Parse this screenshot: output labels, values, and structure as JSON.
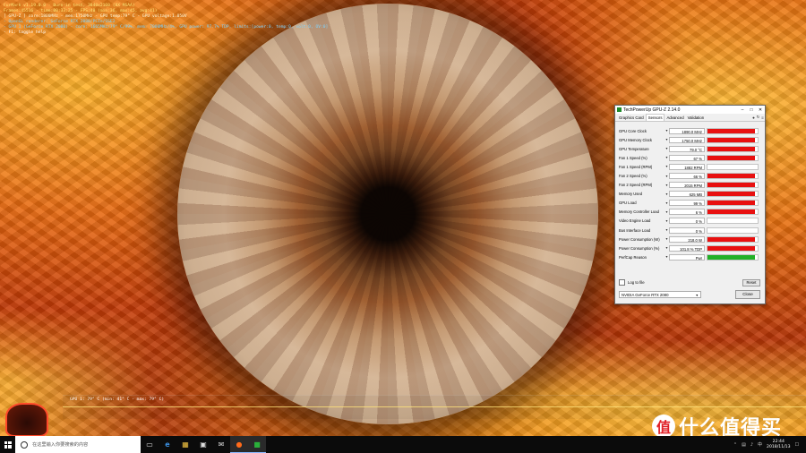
{
  "furmark_osd": {
    "line1": "FurMark v1.19.0.0 - Burn-in test, 3840x2160 (8X MSAA)",
    "line2": "Frames:45516 - time:00:33:25 - FPS:40 (min:36, max:45, avg:41)",
    "line3": "[ GPU-Z ] core:1800MHz - mem:1750MHz - GPU temp:79° C - GPU voltage:1.050V",
    "line4": "- OpenGL renderer: GeForce RTX 2080/PCIe/SSE2",
    "line5": "- GPU 1 (GeForce RTX 2080) - core: 1665MHz/79° C/99%, mem: 7000MHz/4%, GPU power: 97.7% TDP, limits:[power:0, temp:0, volt:0, OV:0]",
    "line6": "- F1: toggle help",
    "graph_label": "GPU 1: 79° C (min: 41° C - max: 79° C)"
  },
  "gpuz": {
    "title": "TechPowerUp GPU-Z 2.14.0",
    "tabs": [
      "Graphics Card",
      "Sensors",
      "Advanced",
      "Validation"
    ],
    "active_tab": "Sensors",
    "sensors": [
      {
        "label": "GPU Core Clock",
        "value": "1890.0 MHz",
        "fill": 0.95,
        "style": "red"
      },
      {
        "label": "GPU Memory Clock",
        "value": "1750.0 MHz",
        "fill": 0.95,
        "style": "red"
      },
      {
        "label": "GPU Temperature",
        "value": "79.0 °C",
        "fill": 0.95,
        "style": "red"
      },
      {
        "label": "Fan 1 Speed (%)",
        "value": "67 %",
        "fill": 0.95,
        "style": "red"
      },
      {
        "label": "Fan 1 Speed (RPM)",
        "value": "1882 RPM",
        "fill": 0.0,
        "style": "red"
      },
      {
        "label": "Fan 2 Speed (%)",
        "value": "66 %",
        "fill": 0.95,
        "style": "red"
      },
      {
        "label": "Fan 2 Speed (RPM)",
        "value": "2015 RPM",
        "fill": 0.95,
        "style": "red"
      },
      {
        "label": "Memory Used",
        "value": "625 MB",
        "fill": 0.95,
        "style": "red"
      },
      {
        "label": "GPU Load",
        "value": "99 %",
        "fill": 0.95,
        "style": "red"
      },
      {
        "label": "Memory Controller Load",
        "value": "6 %",
        "fill": 0.95,
        "style": "red"
      },
      {
        "label": "Video Engine Load",
        "value": "0 %",
        "fill": 0.0,
        "style": "red"
      },
      {
        "label": "Bus Interface Load",
        "value": "0 %",
        "fill": 0.0,
        "style": "red"
      },
      {
        "label": "Power Consumption (W)",
        "value": "218.0 W",
        "fill": 0.95,
        "style": "red"
      },
      {
        "label": "Power Consumption (%)",
        "value": "101.8 % TDP",
        "fill": 0.95,
        "style": "red"
      },
      {
        "label": "PerfCap Reason",
        "value": "Pwr",
        "fill": 0.95,
        "style": "green"
      }
    ],
    "log_label": "Log to file",
    "reset_label": "Reset",
    "device": "NVIDIA GeForce RTX 2080",
    "close_label": "Close"
  },
  "taskbar": {
    "search_placeholder": "在这里输入你要搜索的内容",
    "time": "22:44",
    "date": "2018/11/13",
    "ime": "中"
  },
  "watermark": {
    "badge": "值",
    "text": "什么值得买"
  }
}
